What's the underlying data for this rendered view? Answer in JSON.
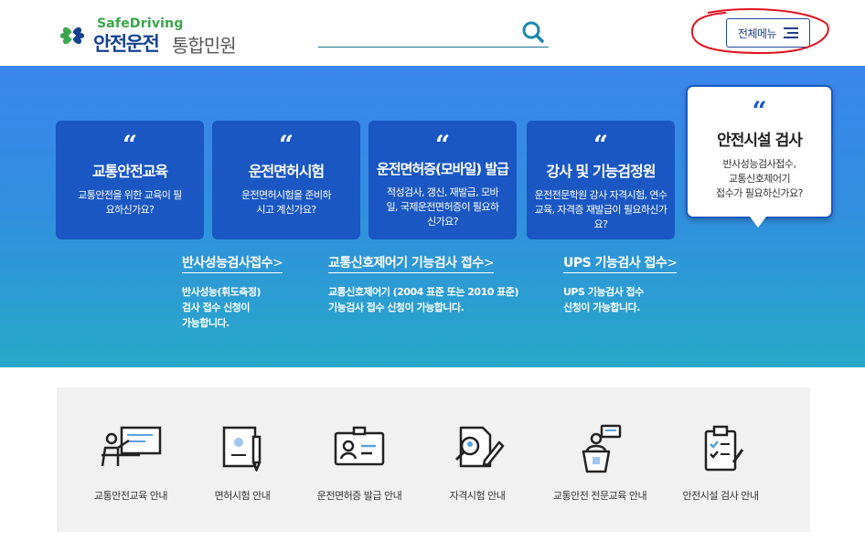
{
  "header": {
    "logo_en": "SafeDriving",
    "logo_ko": "안전운전",
    "logo_sub": "통합민원",
    "search_placeholder": "",
    "menu_label": "전체메뉴"
  },
  "colors": {
    "brand_navy": "#15418f",
    "brand_green": "#3aa54b",
    "card_blue": "#1a57c3",
    "annotation_red": "#e0141e"
  },
  "hero": {
    "cards": [
      {
        "quote": "“",
        "title": "교통안전교육",
        "desc": "교통안전을 위한 교육이 필요하신가요?"
      },
      {
        "quote": "“",
        "title": "운전면허시험",
        "desc": "운전면허시험을 준비하시고 계신가요?"
      },
      {
        "quote": "“",
        "title": "운전면허증(모바일) 발급",
        "desc": "적성검사, 갱신, 재발급, 모바일, 국제운전면허증이 필요하신가요?"
      },
      {
        "quote": "“",
        "title": "강사 및 기능검정원",
        "desc": "운전전문학원 강사 자격시험, 연수교육, 자격증 재발급이 필요하신가요?"
      }
    ],
    "bubble": {
      "quote": "“",
      "title": "안전시설 검사",
      "desc_1": "반사성능검사접수,",
      "desc_2": "교통신호제어기",
      "desc_3": "접수가 필요하신가요?"
    },
    "links": [
      {
        "title": "반사성능검사접수",
        "arrow": ">",
        "desc_1": "반사성능(휘도측정)",
        "desc_2": "검사 접수 신청이",
        "desc_3": "가능합니다."
      },
      {
        "title": "교통신호제어기 기능검사 접수",
        "arrow": ">",
        "desc_1": "교통신호제어기 (2004 표준 또는 2010 표준)",
        "desc_2": "기능검사 접수 신청이 가능합니다."
      },
      {
        "title": "UPS 기능검사 접수",
        "arrow": ">",
        "desc_1": "UPS 기능검사 접수",
        "desc_2": "신청이 가능합니다."
      }
    ]
  },
  "services": [
    {
      "icon": "lecture-icon",
      "label": "교통안전교육 안내"
    },
    {
      "icon": "exam-paper-icon",
      "label": "면허시험 안내"
    },
    {
      "icon": "license-card-icon",
      "label": "운전면허증 발급 안내"
    },
    {
      "icon": "qualification-exam-icon",
      "label": "자격시험 안내"
    },
    {
      "icon": "podium-icon",
      "label": "교통안전 전문교육 안내"
    },
    {
      "icon": "clipboard-check-icon",
      "label": "안전시설 검사 안내"
    }
  ]
}
